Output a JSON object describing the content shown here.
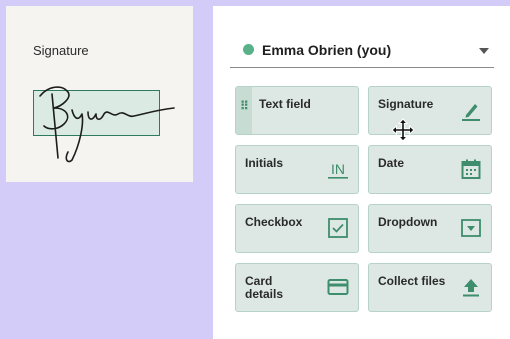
{
  "signature_preview": {
    "label": "Signature"
  },
  "recipient": {
    "name": "Emma Obrien (you)"
  },
  "fields": [
    {
      "label": "Text field",
      "icon": "drag-handle-icon"
    },
    {
      "label": "Signature",
      "icon": "pen-icon"
    },
    {
      "label": "Initials",
      "icon": "initials-icon",
      "icon_text": "IN"
    },
    {
      "label": "Date",
      "icon": "calendar-icon"
    },
    {
      "label": "Checkbox",
      "icon": "checkbox-icon"
    },
    {
      "label": "Dropdown",
      "icon": "dropdown-icon"
    },
    {
      "label": "Card\ndetails",
      "icon": "credit-card-icon"
    },
    {
      "label": "Collect files",
      "icon": "upload-icon"
    }
  ],
  "colors": {
    "accent": "#3e8d6c",
    "field_bg": "#dde8e4",
    "field_border": "#b7d3c8",
    "background": "#d3ccf9"
  }
}
